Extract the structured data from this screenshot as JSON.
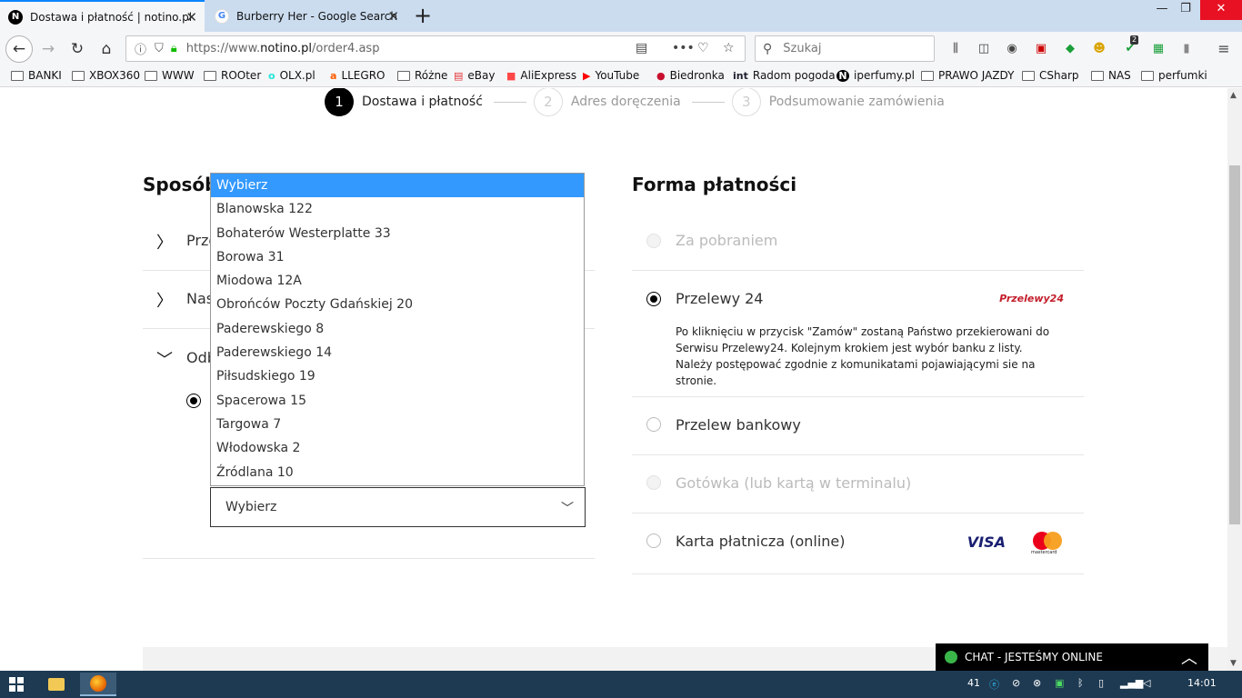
{
  "browser": {
    "tabs": [
      {
        "title": "Dostawa i płatność | notino.pl",
        "favicon": "N"
      },
      {
        "title": "Burberry Her - Google Search",
        "favicon": "G"
      }
    ],
    "url_prefix": "https://www.",
    "url_domain": "notino.pl",
    "url_path": "/order4.asp",
    "search_placeholder": "Szukaj",
    "badge_count": "2",
    "bookmarks": [
      "BANKI",
      "XBOX360",
      "WWW",
      "ROOter",
      "OLX.pl",
      "LLEGRO",
      "Różne",
      "eBay",
      "AliExpress",
      "YouTube",
      "Biedronka",
      "Radom pogoda",
      "iperfumy.pl",
      "PRAWO JAZDY",
      "CSharp",
      "NAS",
      "perfumki"
    ]
  },
  "steps": [
    {
      "num": "1",
      "label": "Dostawa i płatność"
    },
    {
      "num": "2",
      "label": "Adres doręczenia"
    },
    {
      "num": "3",
      "label": "Podsumowanie zamówienia"
    }
  ],
  "shipping": {
    "title": "Sposób",
    "rows": [
      "Prze",
      "Nas",
      "Odb"
    ],
    "select_value": "Wybierz",
    "dropdown_options": [
      "Wybierz",
      "Blanowska 122",
      "Bohaterów Westerplatte 33",
      "Borowa 31",
      "Miodowa 12A",
      "Obrońców Poczty Gdańskiej 20",
      "Paderewskiego 8",
      "Paderewskiego 14",
      "Piłsudskiego 19",
      "Spacerowa 15",
      "Targowa 7",
      "Włodowska 2",
      "Źródlana 10"
    ]
  },
  "payment": {
    "title": "Forma płatności",
    "options": [
      {
        "label": "Za pobraniem",
        "state": "disabled"
      },
      {
        "label": "Przelewy 24",
        "state": "selected"
      },
      {
        "label": "Przelew bankowy",
        "state": "enabled"
      },
      {
        "label": "Gotówka (lub kartą w terminalu)",
        "state": "disabled"
      },
      {
        "label": "Karta płatnicza (online)",
        "state": "enabled"
      }
    ],
    "p24_description": "Po kliknięciu w przycisk \"Zamów\" zostaną Państwo przekierowani do Serwisu Przelewy24. Kolejnym krokiem jest wybór banku z listy. Należy postępować zgodnie z komunikatami pojawiającymi sie na stronie.",
    "p24_logo": "Przelewy24",
    "visa_logo": "VISA",
    "mastercard_logo": "mastercard"
  },
  "chat": {
    "label": "CHAT - JESTEŚMY ONLINE"
  },
  "taskbar": {
    "tray_number": "41",
    "clock": "14:01"
  },
  "colors": {
    "accent": "#3399ff",
    "chat_online": "#3ab54a",
    "tab_bar": "#cbdcef",
    "taskbar": "#1e3a52"
  }
}
